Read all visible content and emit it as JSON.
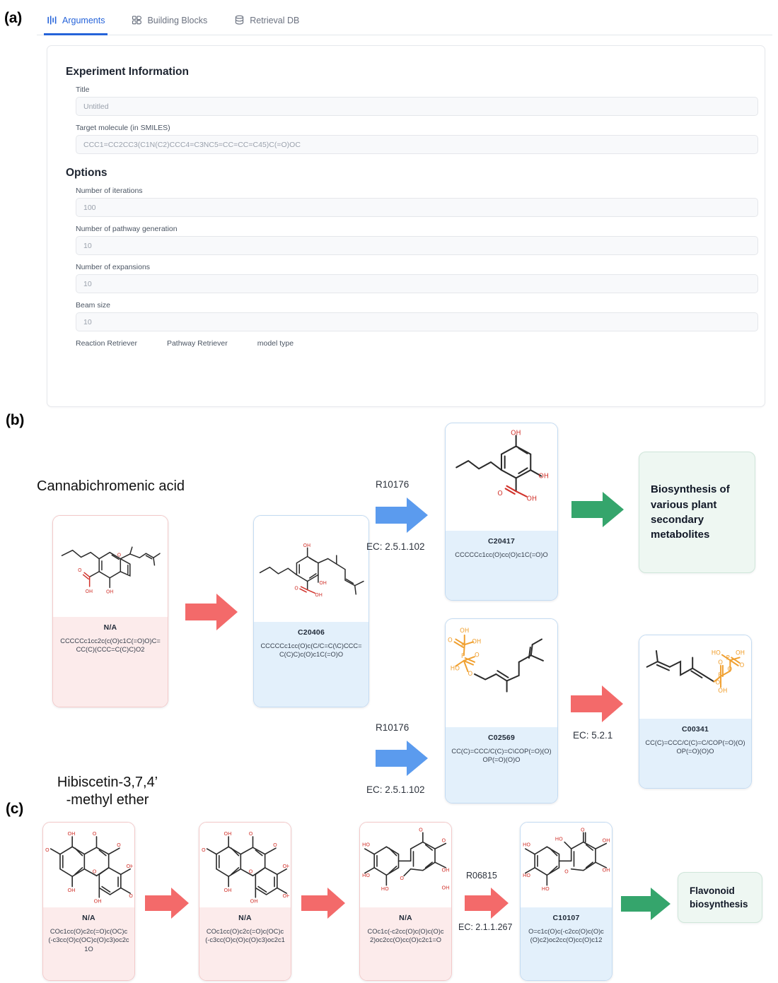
{
  "panels": {
    "a_label": "(a)",
    "b_label": "(b)",
    "c_label": "(c)"
  },
  "app": {
    "tabs": [
      {
        "label": "Arguments",
        "icon": "bars-chart-icon",
        "active": true
      },
      {
        "label": "Building Blocks",
        "icon": "building-blocks-icon",
        "active": false
      },
      {
        "label": "Retrieval DB",
        "icon": "database-icon",
        "active": false
      }
    ],
    "sections": {
      "experiment_information": "Experiment Information",
      "options": "Options"
    },
    "fields": [
      {
        "label": "Title",
        "value": "Untitled"
      },
      {
        "label": "Target molecule (in SMILES)",
        "value": "CCC1=CC2CC3(C1N(C2)CCC4=C3NC5=CC=CC=C45)C(=O)OC"
      },
      {
        "label": "Number of iterations",
        "value": "100"
      },
      {
        "label": "Number of pathway generation",
        "value": "10"
      },
      {
        "label": "Number of expansions",
        "value": "10"
      },
      {
        "label": "Beam size",
        "value": "10"
      }
    ],
    "retrievers": [
      "Reaction Retriever",
      "Pathway Retriever",
      "model type"
    ]
  },
  "pathway_b": {
    "target_name": "Cannabichromenic acid",
    "nodes": [
      {
        "id": "N/A",
        "smiles": "CCCCCc1cc2c(c(O)c1C(=O)O)C=CC(C)(CCC=C(C)C)O2",
        "color": "red"
      },
      {
        "id": "C20406",
        "smiles": "CCCCCc1cc(O)c(C/C=C(\\C)CCC=C(C)C)c(O)c1C(=O)O",
        "color": "blue"
      },
      {
        "id": "C20417",
        "smiles": "CCCCCc1cc(O)cc(O)c1C(=O)O",
        "color": "blue"
      },
      {
        "id": "C02569",
        "smiles": "CC(C)=CCC/C(C)=C\\COP(=O)(O)OP(=O)(O)O",
        "color": "blue"
      },
      {
        "id": "C00341",
        "smiles": "CC(C)=CCC/C(C)=C/COP(=O)(O)OP(=O)(O)O",
        "color": "blue"
      }
    ],
    "reactions": [
      {
        "rid": "R10176",
        "ec": "EC: 2.5.1.102"
      },
      {
        "rid": "R10176",
        "ec": "EC: 2.5.1.102"
      },
      {
        "rid": "",
        "ec": "EC: 5.2.1"
      }
    ],
    "outcome": "Biosynthesis\nof various\nplant\nsecondary\nmetabolites"
  },
  "pathway_c": {
    "target_name": "Hibiscetin-3,7,4’\n-methyl ether",
    "nodes": [
      {
        "id": "N/A",
        "smiles": "COc1cc(O)c2c(=O)c(OC)c(-c3cc(O)c(OC)c(O)c3)oc2c1O",
        "color": "red"
      },
      {
        "id": "N/A",
        "smiles": "COc1cc(O)c2c(=O)c(OC)c(-c3cc(O)c(O)c(O)c3)oc2c1",
        "color": "red"
      },
      {
        "id": "N/A",
        "smiles": "COc1c(-c2cc(O)c(O)c(O)c2)oc2cc(O)cc(O)c2c1=O",
        "color": "red"
      },
      {
        "id": "C10107",
        "smiles": "O=c1c(O)c(-c2cc(O)c(O)c(O)c2)oc2cc(O)cc(O)c12",
        "color": "blue"
      }
    ],
    "reactions": [
      {
        "rid": "",
        "ec": ""
      },
      {
        "rid": "",
        "ec": ""
      },
      {
        "rid": "R06815",
        "ec": "EC: 2.1.1.267"
      }
    ],
    "outcome": "Flavonoid\nbiosynthesis"
  },
  "colors": {
    "arrow_red": "#f36a6a",
    "arrow_blue": "#5b9bee",
    "arrow_green": "#35a56c",
    "tab_accent": "#2563d9",
    "card_red_fill": "#fcebeb",
    "card_blue_fill": "#e3f0fb",
    "outcome_fill": "#eef7f2"
  }
}
